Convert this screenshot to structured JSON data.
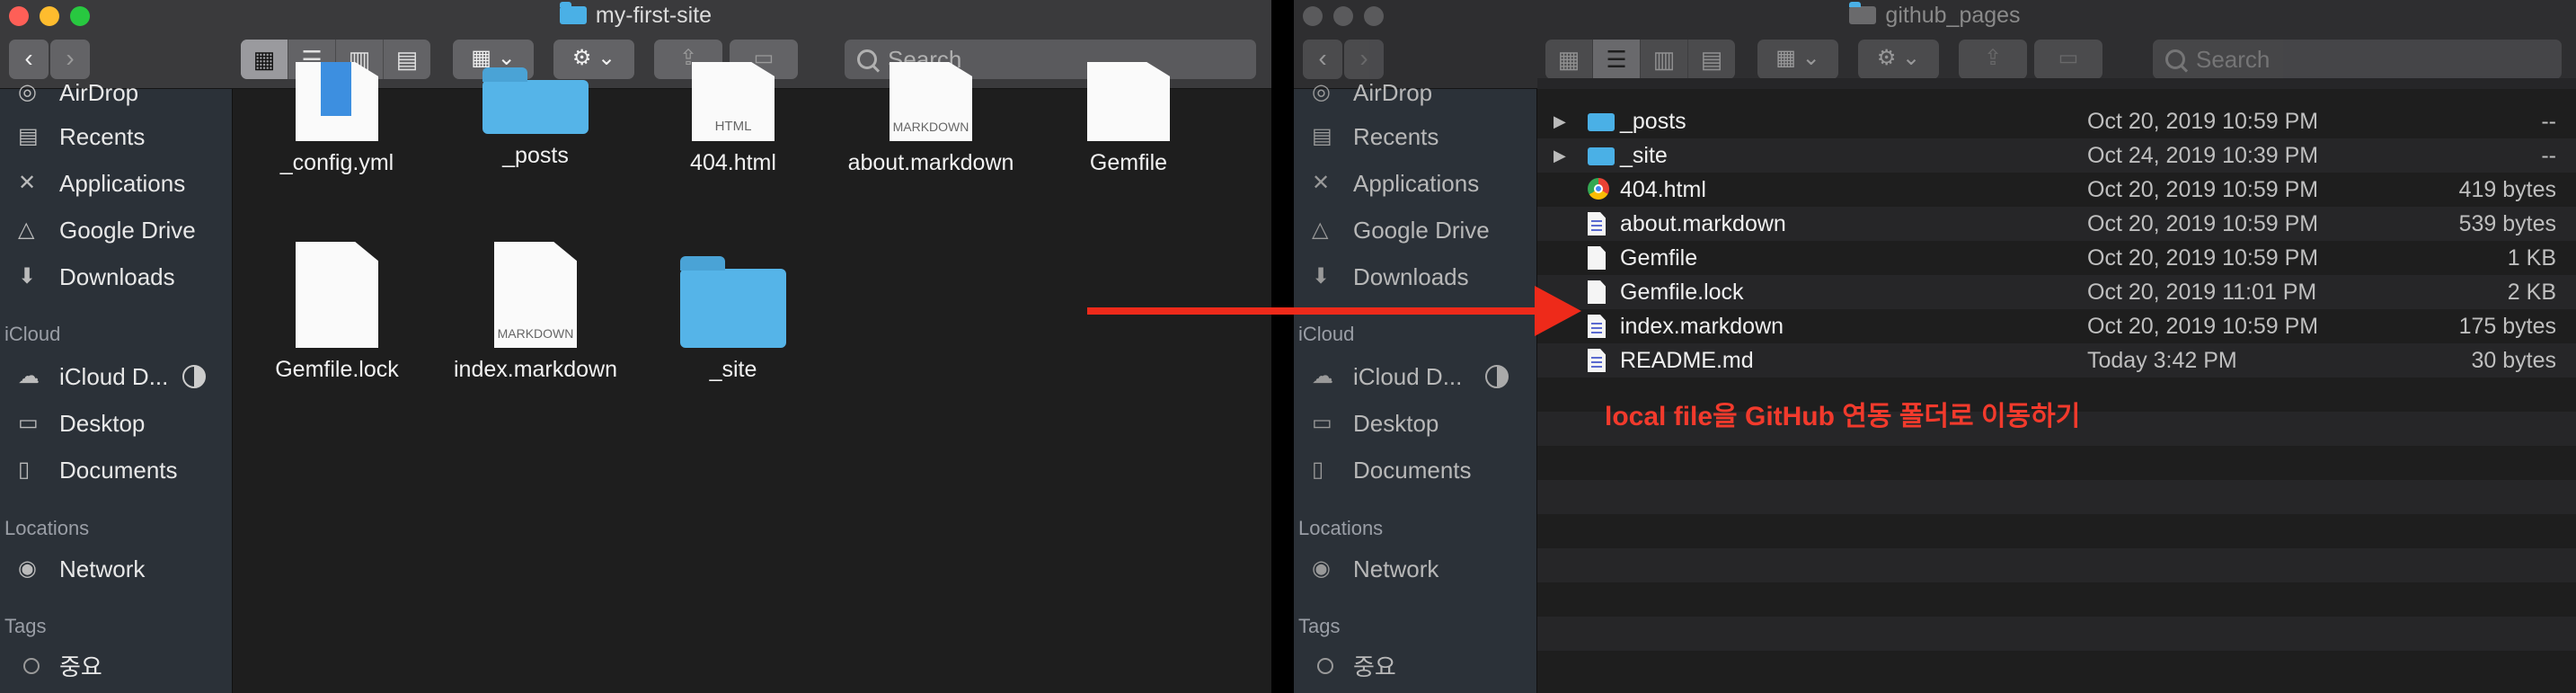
{
  "left_window": {
    "title": "my-first-site",
    "search_placeholder": "Search",
    "sidebar": {
      "items_top": [
        {
          "label": "AirDrop",
          "icon": "airdrop-icon"
        },
        {
          "label": "Recents",
          "icon": "clock-icon"
        },
        {
          "label": "Applications",
          "icon": "applications-icon"
        },
        {
          "label": "Google Drive",
          "icon": "google-drive-icon"
        },
        {
          "label": "Downloads",
          "icon": "download-icon"
        }
      ],
      "icloud_header": "iCloud",
      "icloud_items": [
        {
          "label": "iCloud D...",
          "icon": "cloud-icon"
        },
        {
          "label": "Desktop",
          "icon": "desktop-icon"
        },
        {
          "label": "Documents",
          "icon": "document-icon"
        }
      ],
      "locations_header": "Locations",
      "location_items": [
        {
          "label": "Network",
          "icon": "network-icon"
        }
      ],
      "tags_header": "Tags",
      "tag_items": [
        {
          "label": "중요"
        }
      ]
    },
    "files": [
      {
        "name": "_config.yml",
        "kind": "yml"
      },
      {
        "name": "_posts",
        "kind": "folder"
      },
      {
        "name": "404.html",
        "kind": "html",
        "tag": "HTML"
      },
      {
        "name": "about.markdown",
        "kind": "markdown",
        "tag": "MARKDOWN"
      },
      {
        "name": "Gemfile",
        "kind": "doc"
      },
      {
        "name": "Gemfile.lock",
        "kind": "doc"
      },
      {
        "name": "index.markdown",
        "kind": "markdown",
        "tag": "MARKDOWN"
      },
      {
        "name": "_site",
        "kind": "folder"
      }
    ]
  },
  "right_window": {
    "title": "github_pages",
    "search_placeholder": "Search",
    "sidebar": {
      "items_top": [
        {
          "label": "AirDrop",
          "icon": "airdrop-icon"
        },
        {
          "label": "Recents",
          "icon": "clock-icon"
        },
        {
          "label": "Applications",
          "icon": "applications-icon"
        },
        {
          "label": "Google Drive",
          "icon": "google-drive-icon"
        },
        {
          "label": "Downloads",
          "icon": "download-icon"
        }
      ],
      "icloud_header": "iCloud",
      "icloud_items": [
        {
          "label": "iCloud D...",
          "icon": "cloud-icon"
        },
        {
          "label": "Desktop",
          "icon": "desktop-icon"
        },
        {
          "label": "Documents",
          "icon": "document-icon"
        }
      ],
      "locations_header": "Locations",
      "location_items": [
        {
          "label": "Network",
          "icon": "network-icon"
        }
      ],
      "tags_header": "Tags",
      "tag_items": [
        {
          "label": "중요"
        }
      ]
    },
    "rows": [
      {
        "name": "_posts",
        "date": "Oct 20, 2019 10:59 PM",
        "size": "--",
        "kind": "folder"
      },
      {
        "name": "_site",
        "date": "Oct 24, 2019 10:39 PM",
        "size": "--",
        "kind": "folder"
      },
      {
        "name": "404.html",
        "date": "Oct 20, 2019 10:59 PM",
        "size": "419 bytes",
        "kind": "chrome"
      },
      {
        "name": "about.markdown",
        "date": "Oct 20, 2019 10:59 PM",
        "size": "539 bytes",
        "kind": "md"
      },
      {
        "name": "Gemfile",
        "date": "Oct 20, 2019 10:59 PM",
        "size": "1 KB",
        "kind": "doc"
      },
      {
        "name": "Gemfile.lock",
        "date": "Oct 20, 2019 11:01 PM",
        "size": "2 KB",
        "kind": "doc"
      },
      {
        "name": "index.markdown",
        "date": "Oct 20, 2019 10:59 PM",
        "size": "175 bytes",
        "kind": "md"
      },
      {
        "name": "README.md",
        "date": "Today 3:42 PM",
        "size": "30 bytes",
        "kind": "md"
      }
    ]
  },
  "annotation": {
    "text": "local file을 GitHub 연동 폴더로 이동하기",
    "color": "#f23a2c"
  },
  "colors": {
    "folder": "#4ab0e6",
    "sidebar": "#2b3138",
    "arrow": "#ee2a1a"
  }
}
